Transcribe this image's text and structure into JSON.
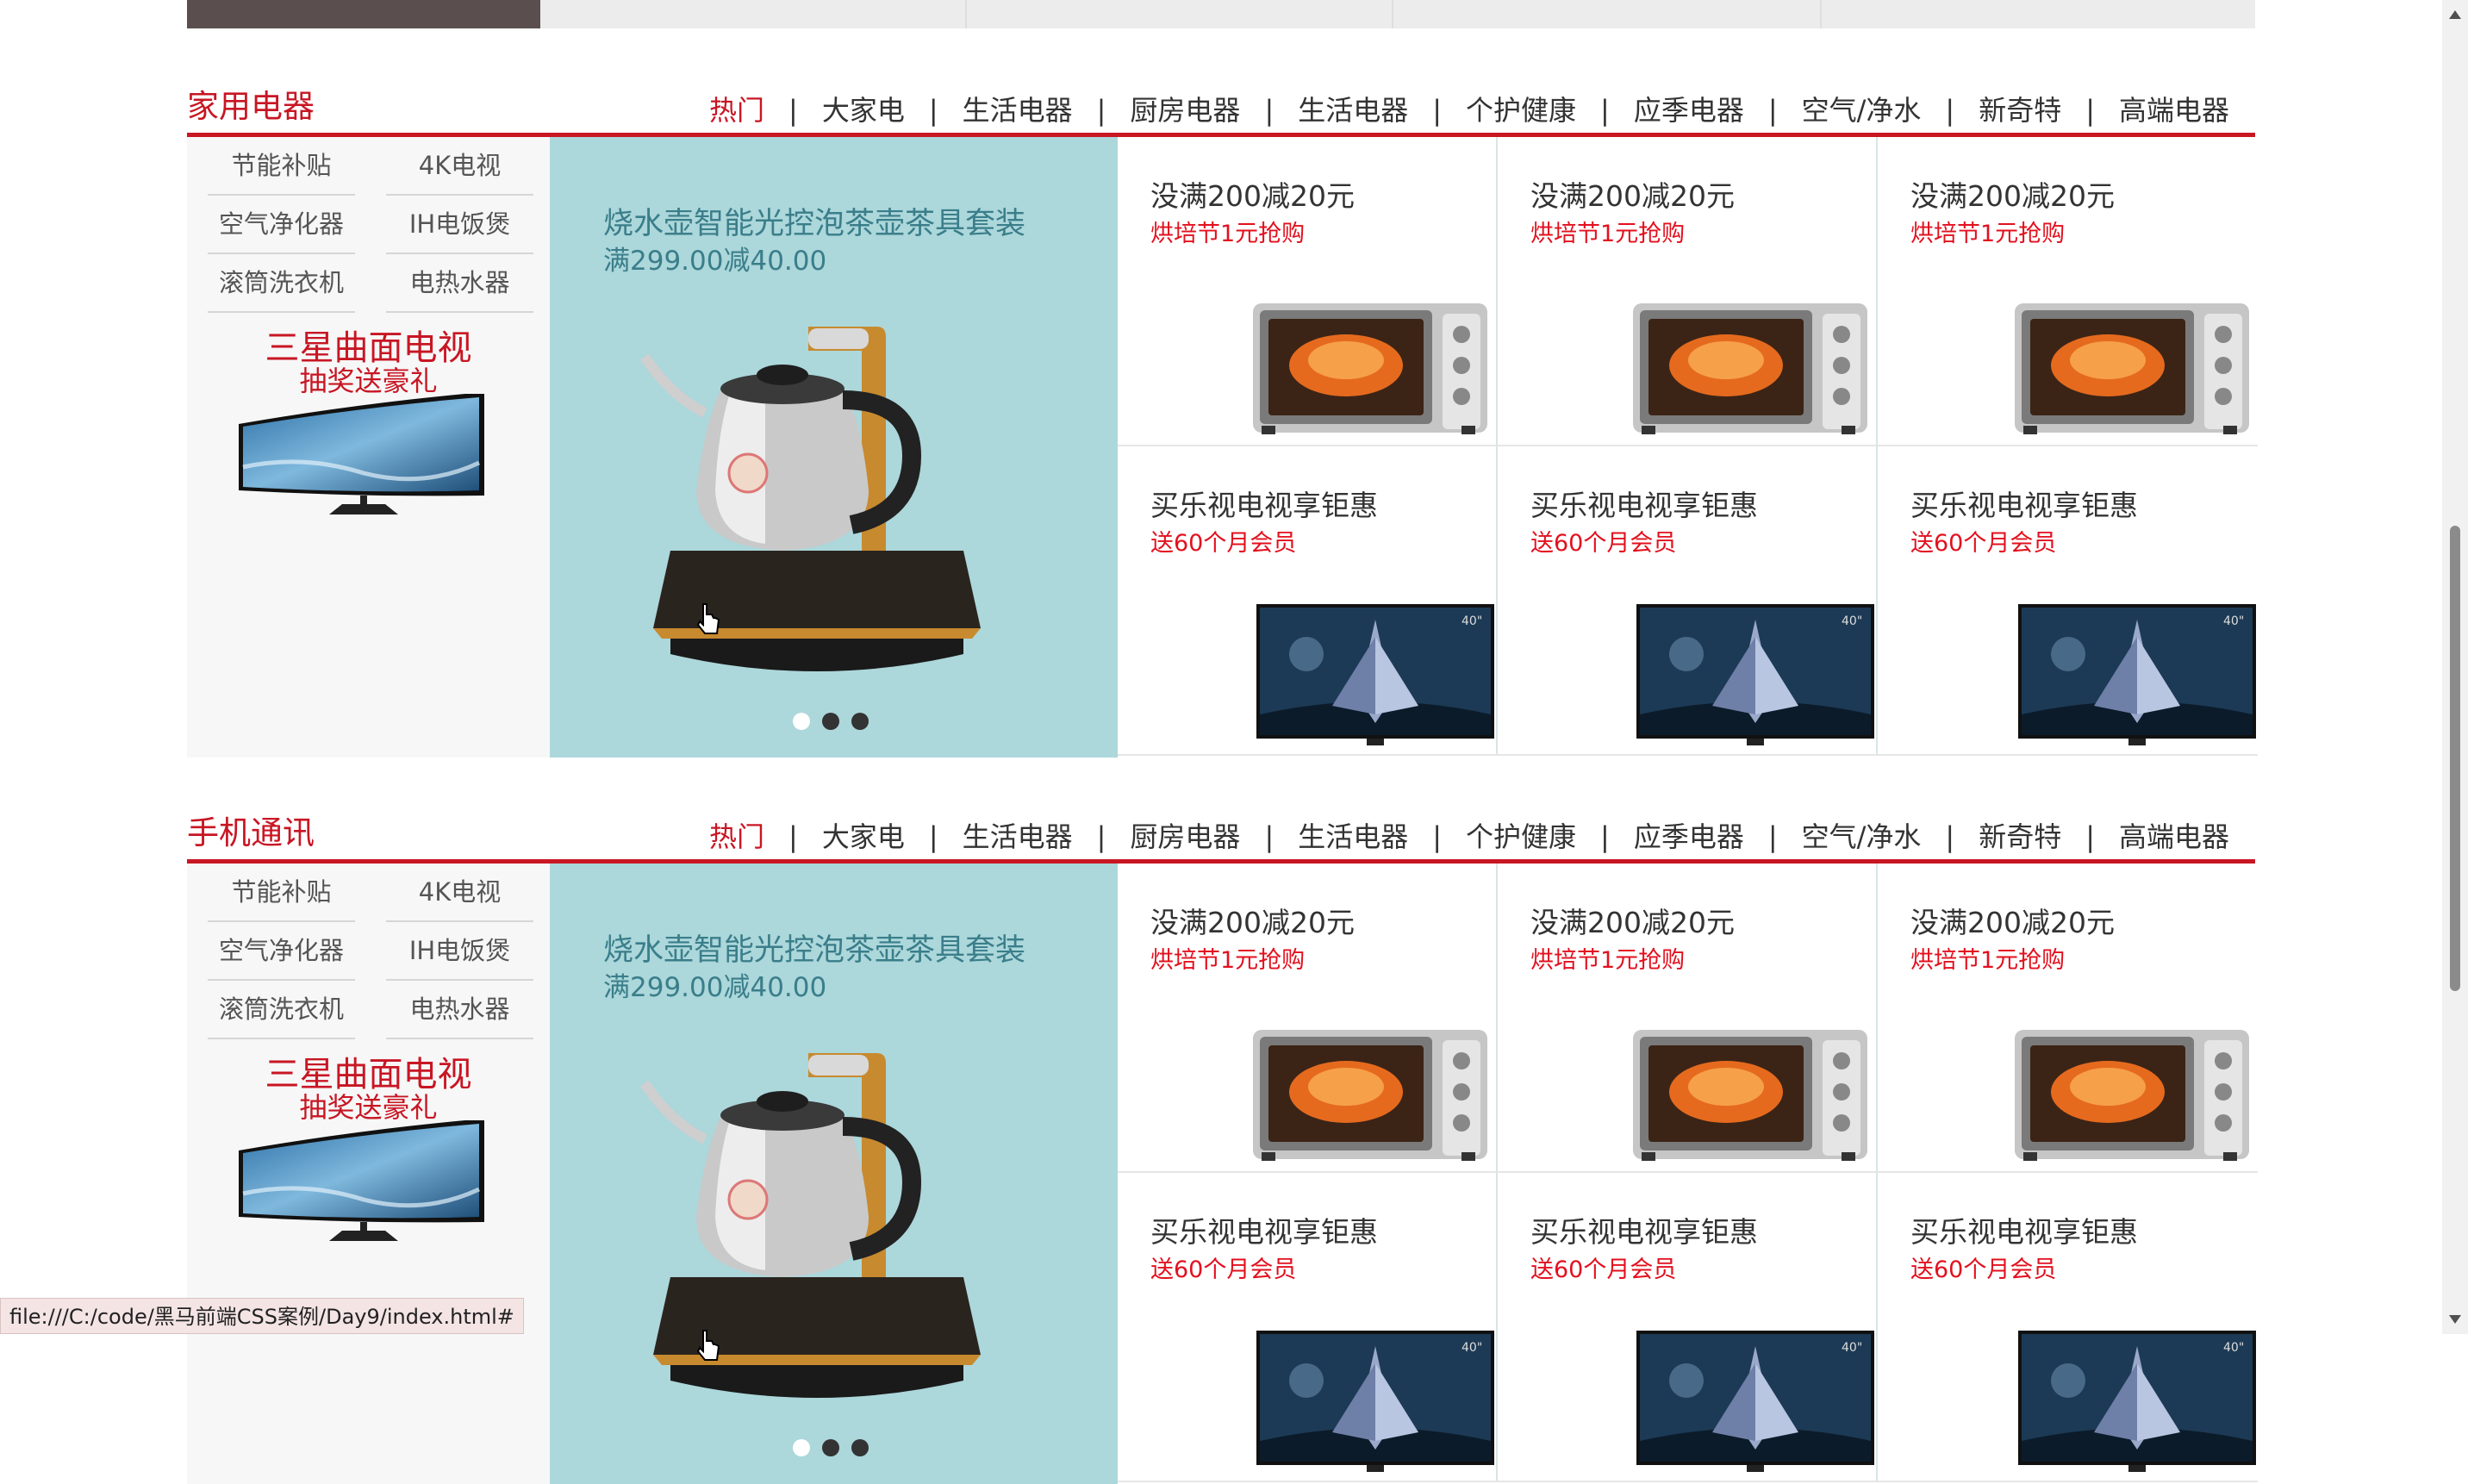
{
  "floors": [
    {
      "title": "家用电器",
      "tabs": [
        "热门",
        "大家电",
        "生活电器",
        "厨房电器",
        "生活电器",
        "个护健康",
        "应季电器",
        "空气/净水",
        "新奇特",
        "高端电器"
      ],
      "separator": "|",
      "keywords": [
        "节能补贴",
        "4K电视",
        "空气净化器",
        "IH电饭煲",
        "滚筒洗衣机",
        "电热水器"
      ],
      "promo_title": "三星曲面电视",
      "promo_sub": "抽奖送豪礼",
      "banner_title": "烧水壶智能光控泡茶壶茶具套装",
      "banner_price": "满299.00减40.00",
      "cells": [
        {
          "title": "没满200减20元",
          "sub": "烘培节1元抢购",
          "image": "oven-image"
        },
        {
          "title": "没满200减20元",
          "sub": "烘培节1元抢购",
          "image": "oven-image"
        },
        {
          "title": "没满200减20元",
          "sub": "烘培节1元抢购",
          "image": "oven-image"
        },
        {
          "title": "买乐视电视享钜惠",
          "sub": "送60个月会员",
          "image": "tv-image"
        },
        {
          "title": "买乐视电视享钜惠",
          "sub": "送60个月会员",
          "image": "tv-image"
        },
        {
          "title": "买乐视电视享钜惠",
          "sub": "送60个月会员",
          "image": "tv-image"
        }
      ]
    },
    {
      "title": "手机通讯",
      "tabs": [
        "热门",
        "大家电",
        "生活电器",
        "厨房电器",
        "生活电器",
        "个护健康",
        "应季电器",
        "空气/净水",
        "新奇特",
        "高端电器"
      ],
      "separator": "|",
      "keywords": [
        "节能补贴",
        "4K电视",
        "空气净化器",
        "IH电饭煲",
        "滚筒洗衣机",
        "电热水器"
      ],
      "promo_title": "三星曲面电视",
      "promo_sub": "抽奖送豪礼",
      "banner_title": "烧水壶智能光控泡茶壶茶具套装",
      "banner_price": "满299.00减40.00",
      "cells": [
        {
          "title": "没满200减20元",
          "sub": "烘培节1元抢购",
          "image": "oven-image"
        },
        {
          "title": "没满200减20元",
          "sub": "烘培节1元抢购",
          "image": "oven-image"
        },
        {
          "title": "没满200减20元",
          "sub": "烘培节1元抢购",
          "image": "oven-image"
        },
        {
          "title": "买乐视电视享钜惠",
          "sub": "送60个月会员",
          "image": "tv-image"
        },
        {
          "title": "买乐视电视享钜惠",
          "sub": "送60个月会员",
          "image": "tv-image"
        },
        {
          "title": "买乐视电视享钜惠",
          "sub": "送60个月会员",
          "image": "tv-image"
        }
      ]
    }
  ],
  "status_url": "file:///C:/code/黑马前端CSS案例/Day9/index.html#",
  "colors": {
    "accent": "#c81623",
    "banner_bg": "#acd7db",
    "banner_text": "#3a7e8a",
    "sub_red": "#e3101e"
  }
}
